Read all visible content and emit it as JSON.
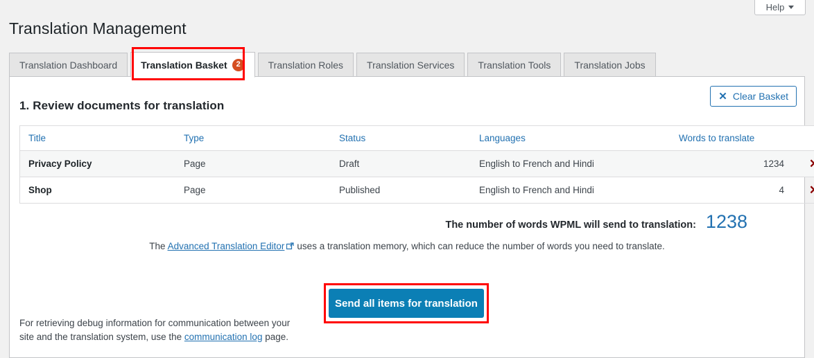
{
  "header": {
    "title": "Translation Management",
    "help_label": "Help",
    "help_caret_icon": "chevron-down-icon"
  },
  "tabs": [
    {
      "label": "Translation Dashboard",
      "active": false,
      "badge": null
    },
    {
      "label": "Translation Basket",
      "active": true,
      "badge": "2"
    },
    {
      "label": "Translation Roles",
      "active": false,
      "badge": null
    },
    {
      "label": "Translation Services",
      "active": false,
      "badge": null
    },
    {
      "label": "Translation Tools",
      "active": false,
      "badge": null
    },
    {
      "label": "Translation Jobs",
      "active": false,
      "badge": null
    }
  ],
  "panel": {
    "clear_basket_label": "Clear Basket",
    "clear_basket_icon": "close-x-icon",
    "section_heading": "1. Review documents for translation"
  },
  "table": {
    "columns": [
      "Title",
      "Type",
      "Status",
      "Languages",
      "Words to translate"
    ],
    "delete_icon": "delete-x-icon",
    "rows": [
      {
        "title": "Privacy Policy",
        "type": "Page",
        "status": "Draft",
        "languages": "English to French and Hindi",
        "words": "1234"
      },
      {
        "title": "Shop",
        "type": "Page",
        "status": "Published",
        "languages": "English to French and Hindi",
        "words": "4"
      }
    ]
  },
  "summary": {
    "label": "The number of words WPML will send to translation:",
    "value": "1238"
  },
  "ate_note": {
    "prefix": "The ",
    "link_text": "Advanced Translation Editor",
    "link_icon": "external-link-icon",
    "suffix": "uses a translation memory, which can reduce the number of words you need to translate."
  },
  "actions": {
    "send_label": "Send all items for translation"
  },
  "footer": {
    "text_before": "For retrieving debug information for communication between your site and the translation system, use the ",
    "link_text": "communication log",
    "text_after": " page."
  },
  "colors": {
    "accent_blue": "#2271b1",
    "button_blue": "#0b7fb5",
    "badge_orange": "#d54e21",
    "highlight_red": "#ff0000",
    "delete_red": "#8b0000"
  }
}
